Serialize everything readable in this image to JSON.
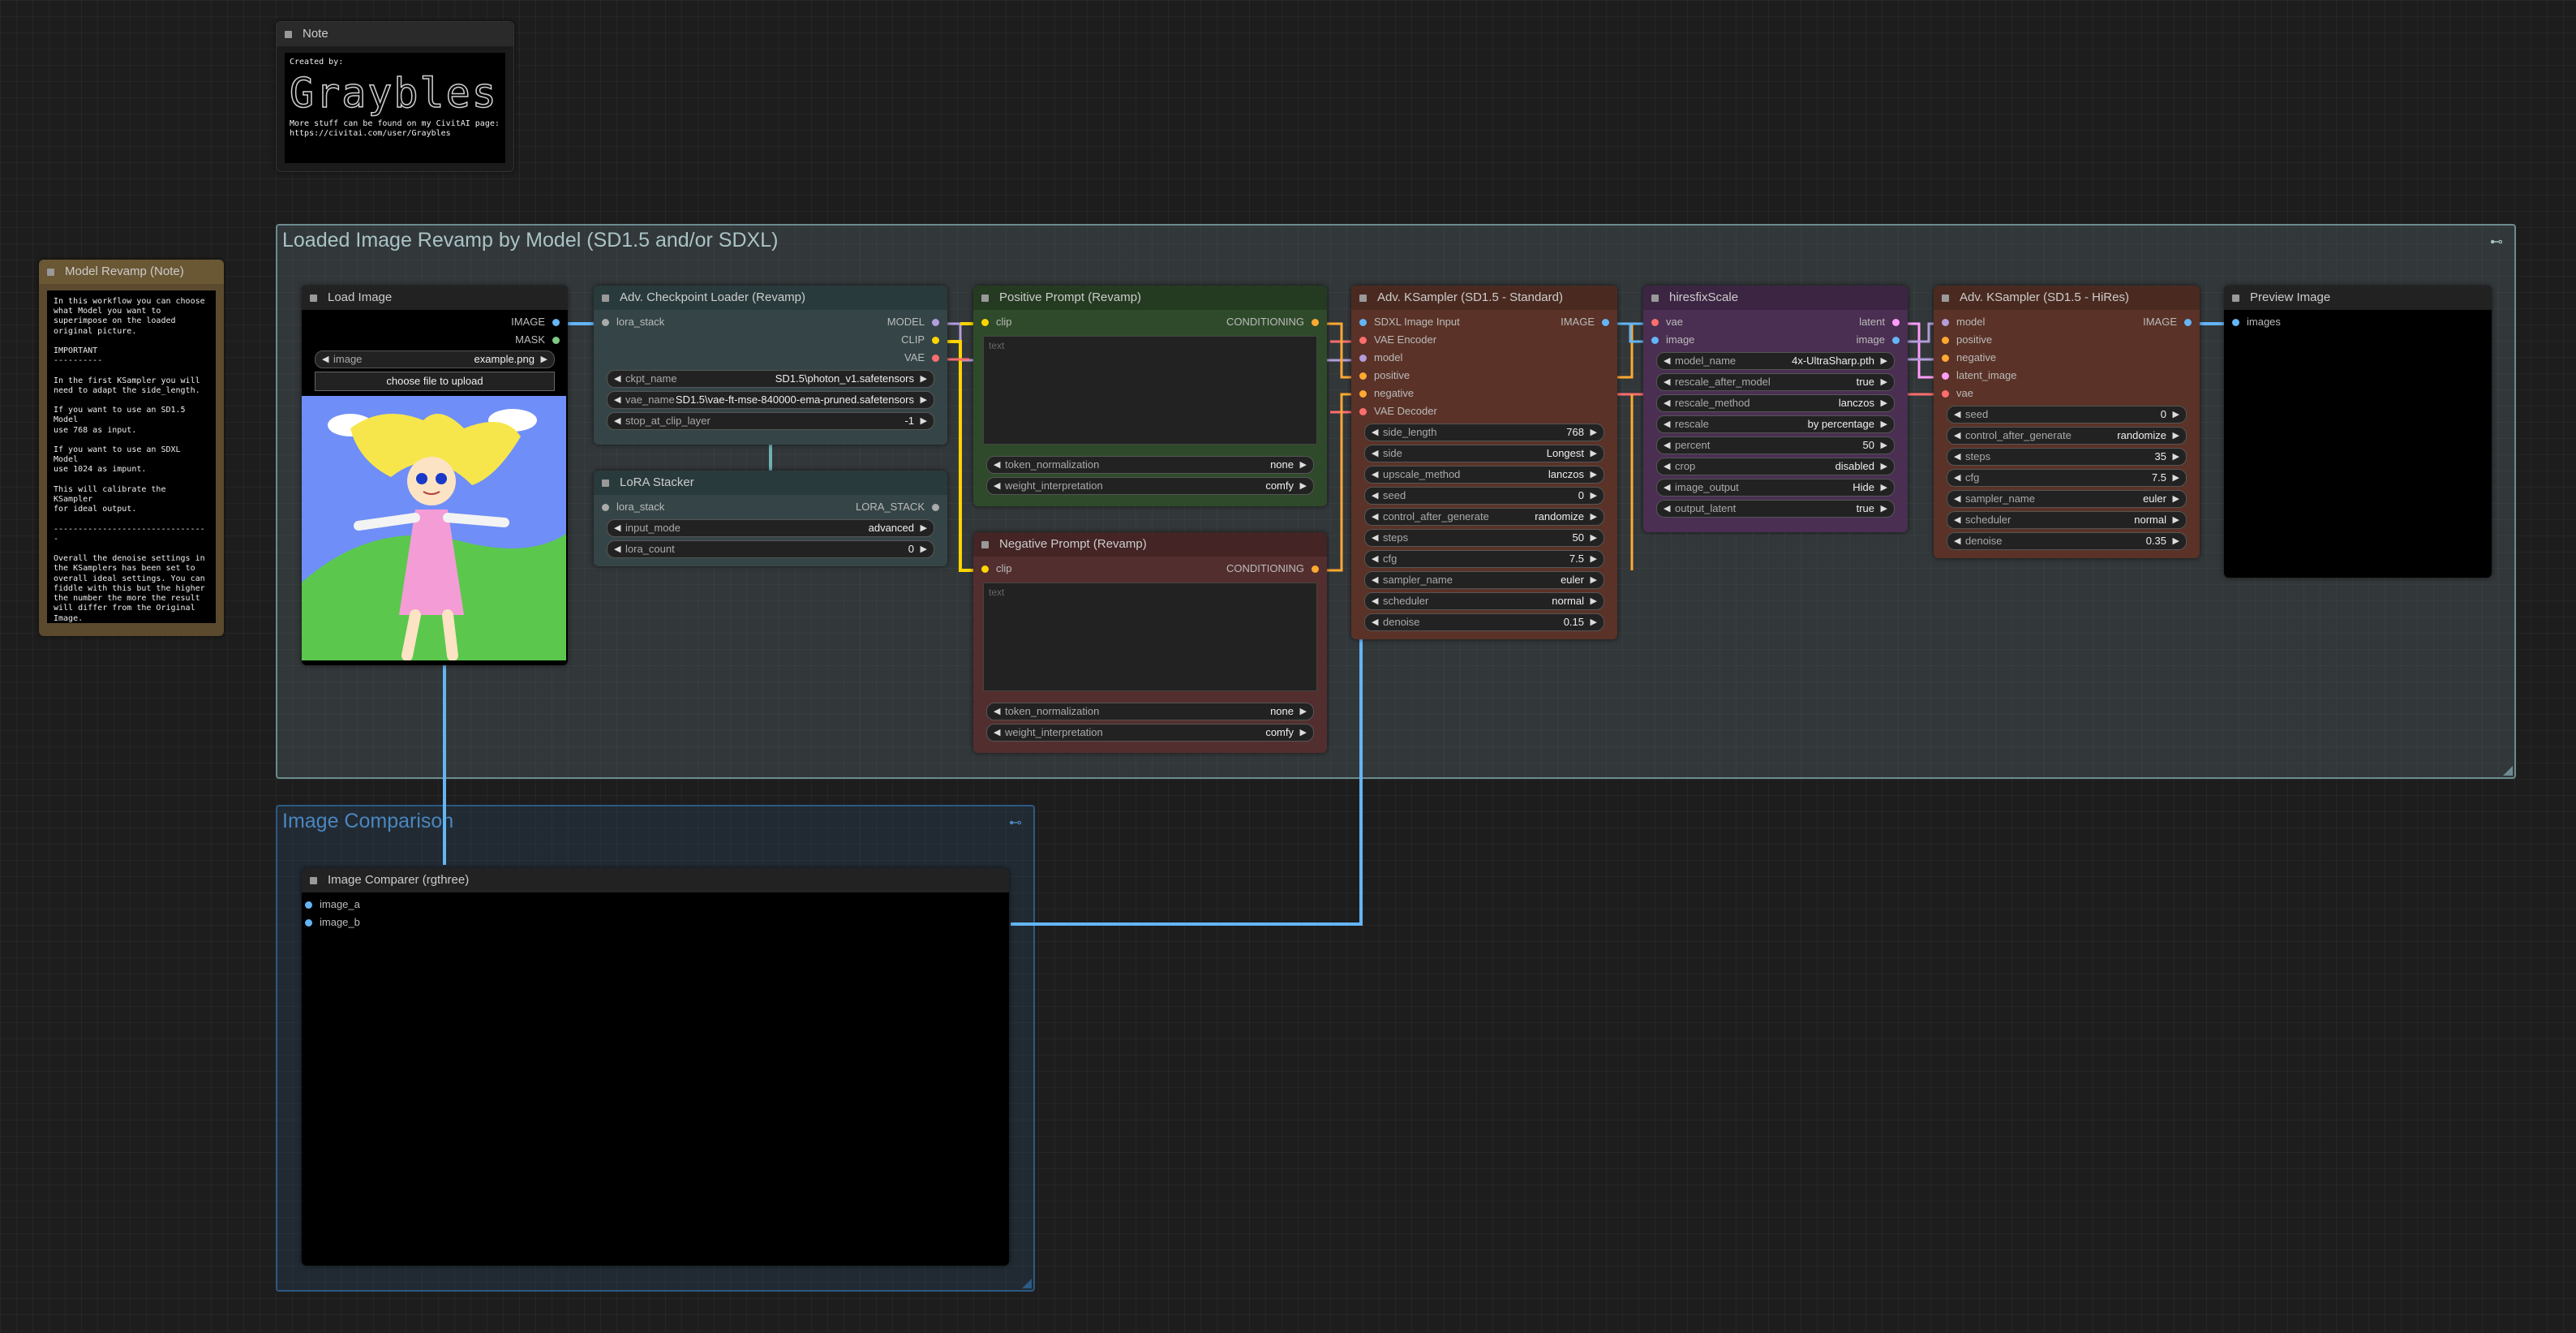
{
  "colors": {
    "image_slot": "#64b5f6",
    "model_slot": "#b39ddb",
    "clip_slot": "#ffd500",
    "vae_slot": "#ff6e6e",
    "conditioning_slot": "#ffa931",
    "latent_slot": "#ff9cf9",
    "lora_slot": "#aaaaaa"
  },
  "groups": {
    "main": {
      "title": "Loaded Image Revamp by Model (SD1.5 and/or SDXL)",
      "ctl": "⊷"
    },
    "compare": {
      "title": "Image Comparison",
      "ctl": "⊷"
    }
  },
  "note_node": {
    "title": "Note",
    "created_by": "Created by:",
    "logo_text": "Graybles",
    "footer": "More stuff can be found on my CivitAI page:\nhttps://civitai.com/user/Graybles"
  },
  "revamp_note": {
    "title": "Model Revamp (Note)",
    "text": "In this workflow you can choose\nwhat Model you want to\nsuperimpose on the loaded\noriginal picture.\n\nIMPORTANT\n----------\n\nIn the first KSampler you will\nneed to adapt the side_length.\n\nIf you want to use an SD1.5 Model\nuse 768 as input.\n\nIf you want to use an SDXL Model\nuse 1024 as impunt.\n\nThis will calibrate the KSampler\nfor ideal output.\n\n--------------------------------\n\nOverall the denoise settings in\nthe KSamplers has been set to\noverall ideal settings. You can\nfiddle with this but the higher\nthe number the more the result\nwill differ from the Original\nImage."
  },
  "load_image": {
    "title": "Load Image",
    "outputs": [
      "IMAGE",
      "MASK"
    ],
    "image_label": "image",
    "image_value": "example.png",
    "upload_label": "choose file to upload"
  },
  "checkpoint": {
    "title": "Adv. Checkpoint Loader (Revamp)",
    "input": "lora_stack",
    "outputs": [
      "MODEL",
      "CLIP",
      "VAE"
    ],
    "widgets": [
      {
        "label": "ckpt_name",
        "value": "SD1.5\\photon_v1.safetensors"
      },
      {
        "label": "vae_name",
        "value": "SD1.5\\vae-ft-mse-840000-ema-pruned.safetensors"
      },
      {
        "label": "stop_at_clip_layer",
        "value": "-1"
      }
    ]
  },
  "lora": {
    "title": "LoRA Stacker",
    "input": "lora_stack",
    "output": "LORA_STACK",
    "widgets": [
      {
        "label": "input_mode",
        "value": "advanced"
      },
      {
        "label": "lora_count",
        "value": "0"
      }
    ]
  },
  "positive": {
    "title": "Positive Prompt (Revamp)",
    "input": "clip",
    "output": "CONDITIONING",
    "placeholder": "text",
    "widgets": [
      {
        "label": "token_normalization",
        "value": "none"
      },
      {
        "label": "weight_interpretation",
        "value": "comfy"
      }
    ]
  },
  "negative": {
    "title": "Negative Prompt (Revamp)",
    "input": "clip",
    "output": "CONDITIONING",
    "placeholder": "text",
    "widgets": [
      {
        "label": "token_normalization",
        "value": "none"
      },
      {
        "label": "weight_interpretation",
        "value": "comfy"
      }
    ]
  },
  "ksampler1": {
    "title": "Adv. KSampler (SD1.5 - Standard)",
    "inputs": [
      "SDXL Image Input",
      "VAE Encoder",
      "model",
      "positive",
      "negative",
      "VAE Decoder"
    ],
    "output": "IMAGE",
    "widgets": [
      {
        "label": "side_length",
        "value": "768"
      },
      {
        "label": "side",
        "value": "Longest"
      },
      {
        "label": "upscale_method",
        "value": "lanczos"
      },
      {
        "label": "seed",
        "value": "0"
      },
      {
        "label": "control_after_generate",
        "value": "randomize"
      },
      {
        "label": "steps",
        "value": "50"
      },
      {
        "label": "cfg",
        "value": "7.5"
      },
      {
        "label": "sampler_name",
        "value": "euler"
      },
      {
        "label": "scheduler",
        "value": "normal"
      },
      {
        "label": "denoise",
        "value": "0.15"
      }
    ]
  },
  "hires": {
    "title": "hiresfixScale",
    "inputs": [
      "vae",
      "image"
    ],
    "outputs": [
      "latent",
      "image"
    ],
    "widgets": [
      {
        "label": "model_name",
        "value": "4x-UltraSharp.pth"
      },
      {
        "label": "rescale_after_model",
        "value": "true"
      },
      {
        "label": "rescale_method",
        "value": "lanczos"
      },
      {
        "label": "rescale",
        "value": "by percentage"
      },
      {
        "label": "percent",
        "value": "50"
      },
      {
        "label": "crop",
        "value": "disabled"
      },
      {
        "label": "image_output",
        "value": "Hide"
      },
      {
        "label": "output_latent",
        "value": "true"
      }
    ]
  },
  "ksampler2": {
    "title": "Adv. KSampler (SD1.5 - HiRes)",
    "inputs": [
      "model",
      "positive",
      "negative",
      "latent_image",
      "vae"
    ],
    "output": "IMAGE",
    "widgets": [
      {
        "label": "seed",
        "value": "0"
      },
      {
        "label": "control_after_generate",
        "value": "randomize"
      },
      {
        "label": "steps",
        "value": "35"
      },
      {
        "label": "cfg",
        "value": "7.5"
      },
      {
        "label": "sampler_name",
        "value": "euler"
      },
      {
        "label": "scheduler",
        "value": "normal"
      },
      {
        "label": "denoise",
        "value": "0.35"
      }
    ]
  },
  "preview": {
    "title": "Preview Image",
    "input": "images"
  },
  "comparer": {
    "title": "Image Comparer (rgthree)",
    "inputs": [
      "image_a",
      "image_b"
    ]
  }
}
